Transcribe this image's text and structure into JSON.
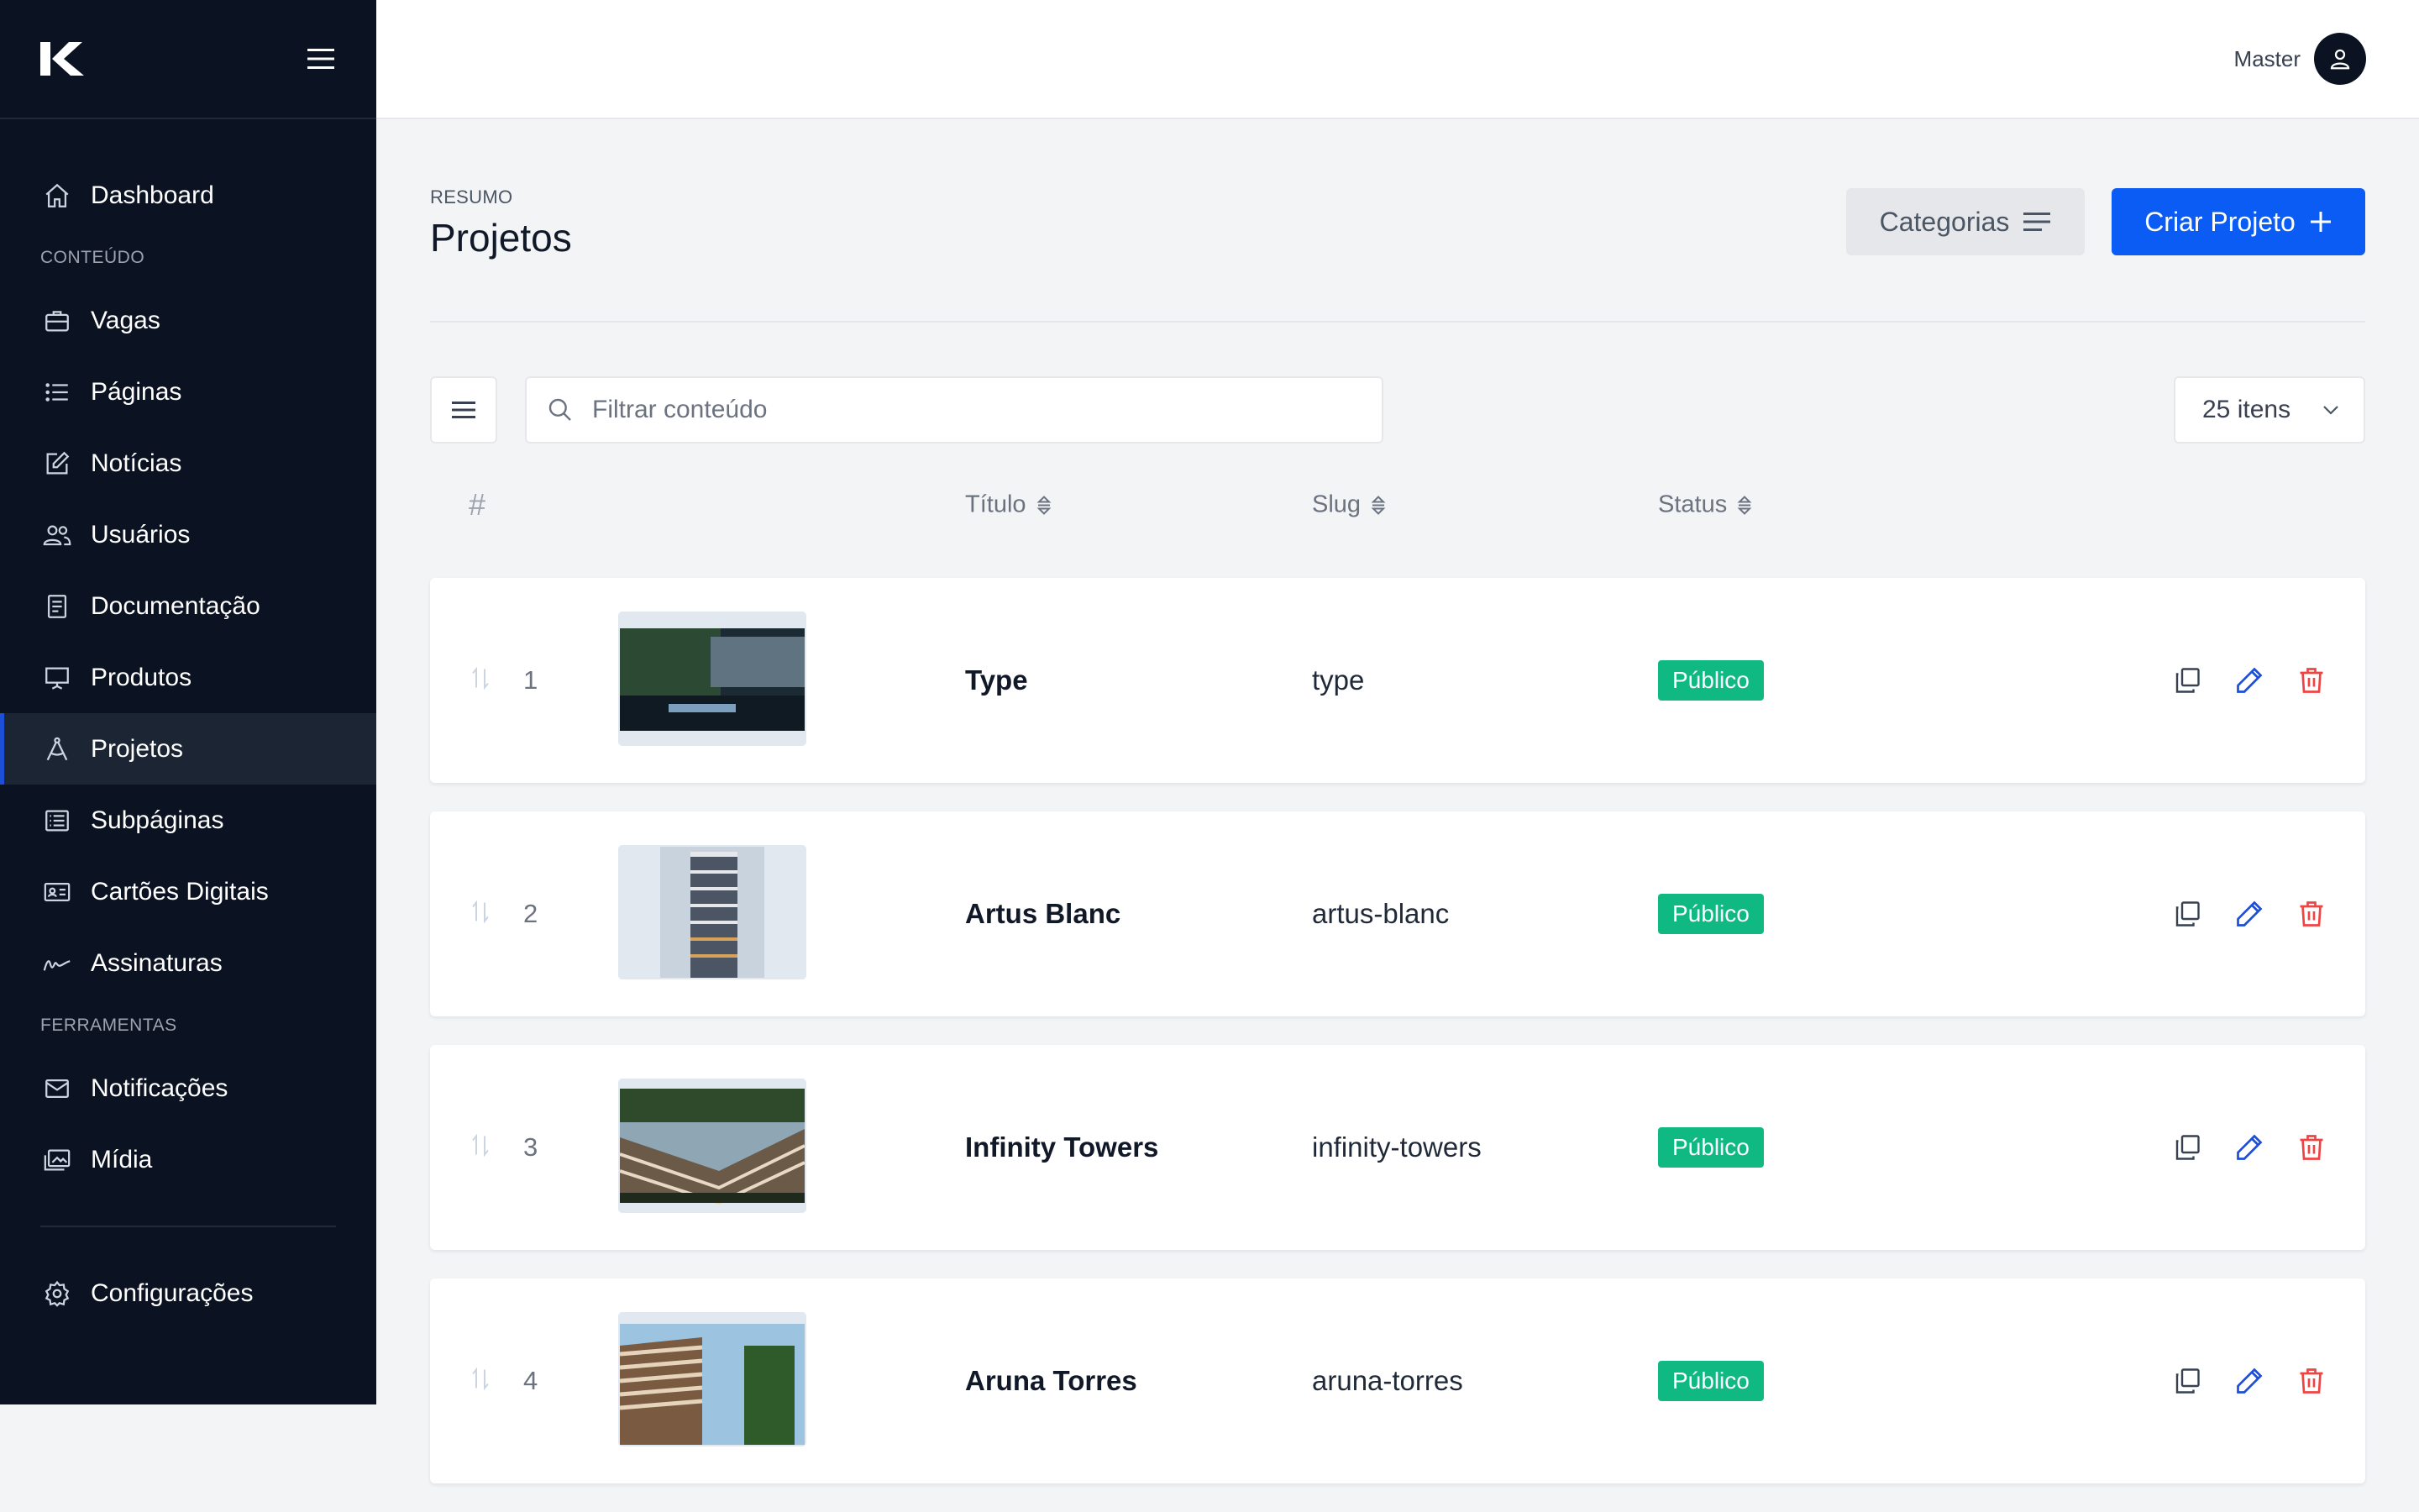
{
  "brand": {
    "logo_icon": "k-logo-icon",
    "menu_icon": "hamburger-icon"
  },
  "sidebar": {
    "items": [
      {
        "label": "Dashboard",
        "icon": "home-icon"
      },
      {
        "label": "Vagas",
        "icon": "briefcase-icon"
      },
      {
        "label": "Páginas",
        "icon": "list-icon"
      },
      {
        "label": "Notícias",
        "icon": "edit-icon"
      },
      {
        "label": "Usuários",
        "icon": "users-icon"
      },
      {
        "label": "Documentação",
        "icon": "document-icon"
      },
      {
        "label": "Produtos",
        "icon": "presentation-icon"
      },
      {
        "label": "Projetos",
        "icon": "compass-icon",
        "active": true
      },
      {
        "label": "Subpáginas",
        "icon": "table-list-icon"
      },
      {
        "label": "Cartões Digitais",
        "icon": "id-card-icon"
      },
      {
        "label": "Assinaturas",
        "icon": "signature-icon"
      },
      {
        "label": "Notificações",
        "icon": "mail-icon"
      },
      {
        "label": "Mídia",
        "icon": "images-icon"
      },
      {
        "label": "Configurações",
        "icon": "gear-icon"
      }
    ],
    "sections": {
      "content": "CONTEÚDO",
      "tools": "FERRAMENTAS"
    }
  },
  "topbar": {
    "user_name": "Master",
    "avatar_icon": "user-icon"
  },
  "header": {
    "eyebrow": "RESUMO",
    "title": "Projetos",
    "categories_label": "Categorias",
    "create_label": "Criar Projeto"
  },
  "toolbar": {
    "search_placeholder": "Filtrar conteúdo",
    "search_value": "",
    "per_page": "25 itens"
  },
  "table": {
    "columns": {
      "hash": "#",
      "title": "Título",
      "slug": "Slug",
      "status": "Status"
    },
    "rows": [
      {
        "num": "1",
        "title": "Type",
        "slug": "type",
        "status": "Público"
      },
      {
        "num": "2",
        "title": "Artus Blanc",
        "slug": "artus-blanc",
        "status": "Público"
      },
      {
        "num": "3",
        "title": "Infinity Towers",
        "slug": "infinity-towers",
        "status": "Público"
      },
      {
        "num": "4",
        "title": "Aruna Torres",
        "slug": "aruna-torres",
        "status": "Público"
      }
    ]
  },
  "colors": {
    "sidebar_bg": "#0b1221",
    "primary": "#0a5cf5",
    "status_public": "#10b981",
    "delete": "#ef4444",
    "edit": "#1d4ed8"
  }
}
